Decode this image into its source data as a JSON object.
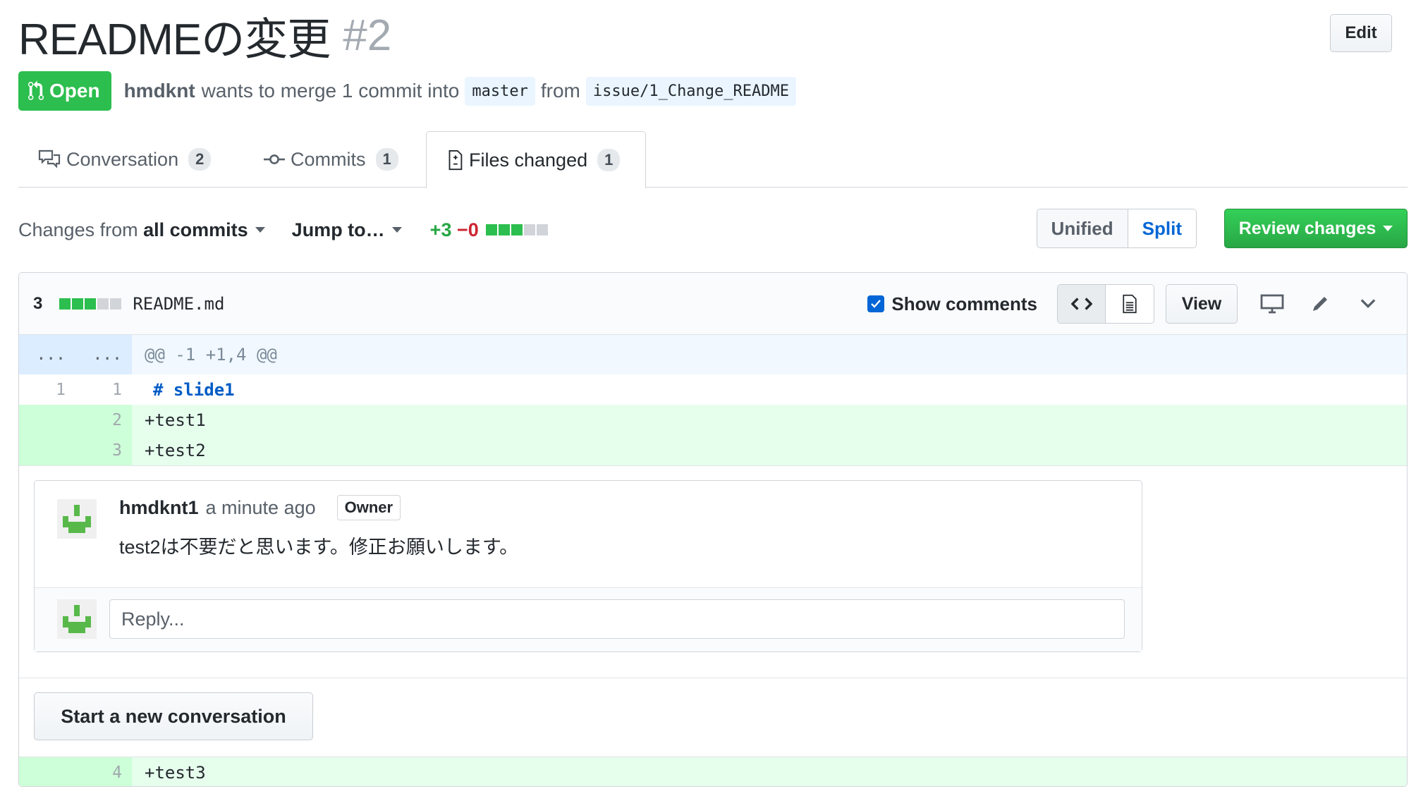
{
  "pr": {
    "title": "READMEの変更",
    "number": "#2",
    "edit_label": "Edit",
    "state": "Open",
    "author": "hmdknt",
    "merge_text": "wants to merge 1 commit into",
    "base_branch": "master",
    "from_text": "from",
    "head_branch": "issue/1_Change_README"
  },
  "tabs": [
    {
      "label": "Conversation",
      "count": "2",
      "icon": "comment-discussion-icon"
    },
    {
      "label": "Commits",
      "count": "1",
      "icon": "git-commit-icon"
    },
    {
      "label": "Files changed",
      "count": "1",
      "icon": "file-diff-icon",
      "selected": true
    }
  ],
  "toolbar": {
    "changes_prefix": "Changes from",
    "changes_value": "all commits",
    "jump_label": "Jump to…",
    "additions": "+3",
    "deletions": "−0",
    "unified_label": "Unified",
    "split_label": "Split",
    "review_label": "Review changes"
  },
  "file": {
    "change_count": "3",
    "name": "README.md",
    "show_comments_label": "Show comments",
    "view_label": "View",
    "hunk_header": "@@ -1 +1,4 @@",
    "hunk_expand_left": "...",
    "hunk_expand_right": "...",
    "lines": [
      {
        "old": "1",
        "new": "1",
        "text": "# slide1",
        "type": "context"
      },
      {
        "old": "",
        "new": "2",
        "text": "+test1",
        "type": "addition"
      },
      {
        "old": "",
        "new": "3",
        "text": "+test2",
        "type": "addition"
      },
      {
        "old": "",
        "new": "4",
        "text": "+test3",
        "type": "addition"
      }
    ]
  },
  "comment": {
    "author": "hmdknt1",
    "time": "a minute ago",
    "badge": "Owner",
    "body": "test2は不要だと思います。修正お願いします。",
    "reply_placeholder": "Reply..."
  },
  "new_conversation_label": "Start a new conversation",
  "colors": {
    "open_green": "#2cbe4e",
    "link_blue": "#0366d6",
    "addition_bg": "#e6ffed",
    "hunk_bg": "#f1f8ff"
  }
}
